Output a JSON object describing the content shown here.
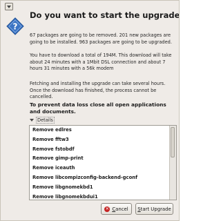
{
  "dialog": {
    "heading": "Do you want to start the upgrade?",
    "paragraphs": [
      "67 packages are going to be removed. 201 new packages are going to be installed. 963 packages are going to be upgraded.",
      "You have to download a total of 194M. This download will take about 24 minutes with a 1Mbit DSL connection and about 7 hours 31 minutes with a 56k modem",
      "Fetching and installing the upgrade can take several hours. Once the download has finished, the process cannot be cancelled."
    ],
    "warning": "To prevent data loss close all open applications and documents.",
    "details_label": "Details",
    "changes": [
      "Remove edlres",
      "Remove fftw3",
      "Remove fstobdf",
      "Remove gimp-print",
      "Remove iceauth",
      "Remove libcompizconfig-backend-gconf",
      "Remove libgnomekbd1",
      "Remove libgnomekbdui1"
    ],
    "buttons": {
      "cancel_mnemonic": "C",
      "cancel_rest": "ancel",
      "start_mnemonic": "S",
      "start_rest": "tart Upgrade"
    }
  },
  "colors": {
    "window_bg": "#efebe7",
    "icon_blue": "#3b74c4",
    "cancel_red": "#c62424"
  },
  "icons": {
    "window_menu": "window-menu-icon",
    "dialog": "question-diamond-icon",
    "expander": "triangle-down-icon",
    "cancel": "cancel-icon"
  }
}
